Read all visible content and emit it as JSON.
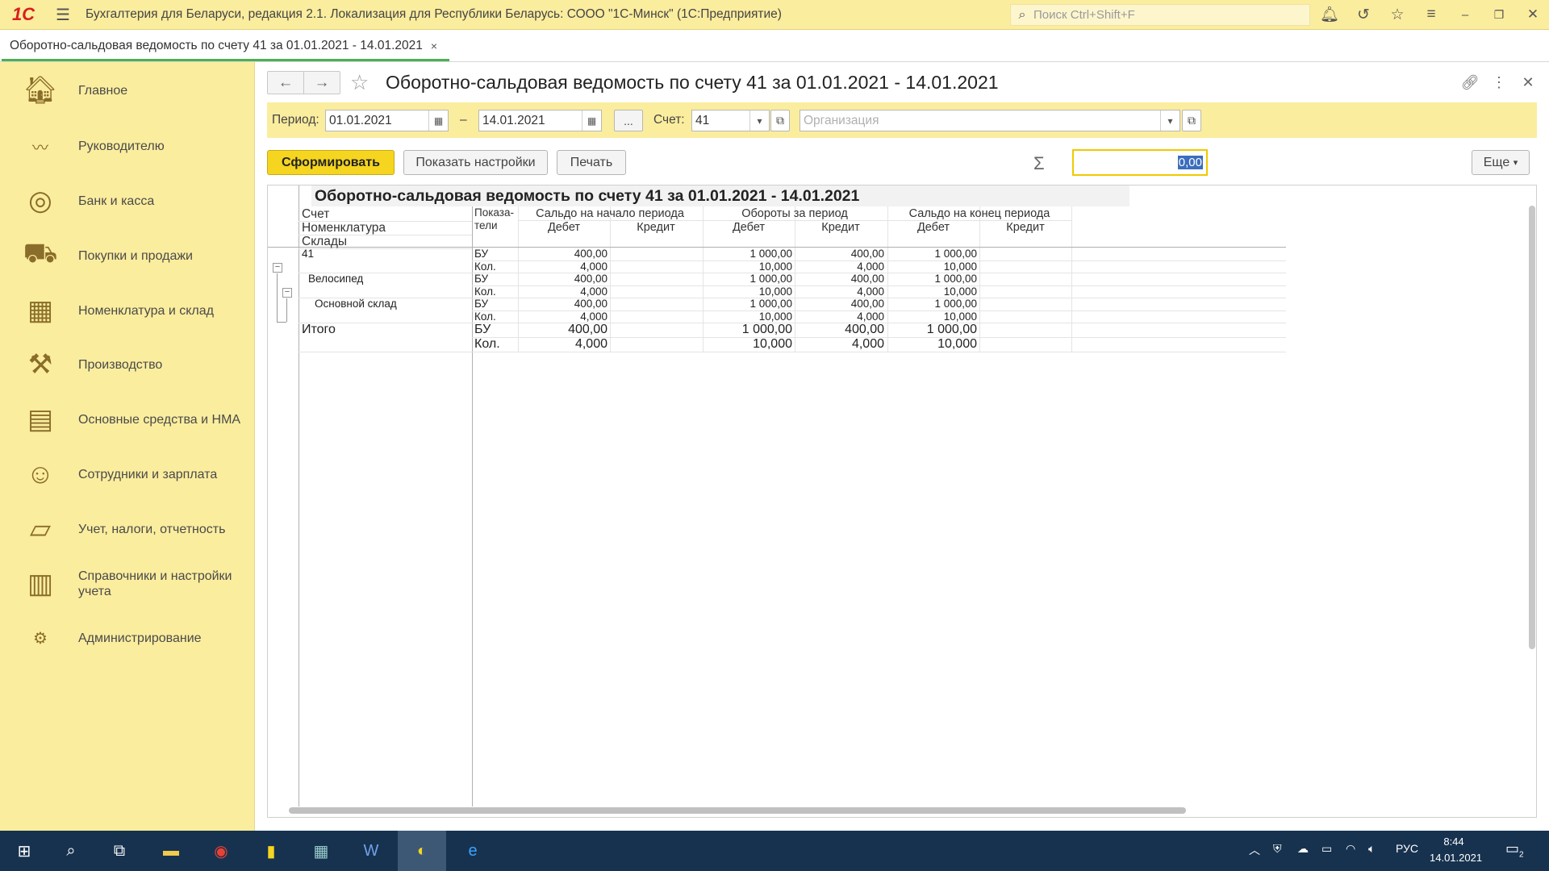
{
  "titlebar": {
    "logo": "1С",
    "app_title": "Бухгалтерия для Беларуси, редакция 2.1. Локализация для Республики Беларусь: СООО \"1С-Минск\"  (1С:Предприятие)",
    "search_placeholder": "Поиск Ctrl+Shift+F"
  },
  "tab": {
    "label": "Оборотно-сальдовая ведомость по счету 41 за 01.01.2021 - 14.01.2021",
    "close": "×"
  },
  "sidebar": {
    "items": [
      {
        "label": "Главное",
        "icon": "home-icon"
      },
      {
        "label": "Руководителю",
        "icon": "trend-icon"
      },
      {
        "label": "Банк и касса",
        "icon": "coins-icon"
      },
      {
        "label": "Покупки и продажи",
        "icon": "truck-icon"
      },
      {
        "label": "Номенклатура и склад",
        "icon": "warehouse-icon"
      },
      {
        "label": "Производство",
        "icon": "tools-icon"
      },
      {
        "label": "Основные средства и НМА",
        "icon": "assets-icon"
      },
      {
        "label": "Сотрудники и зарплата",
        "icon": "employee-icon"
      },
      {
        "label": "Учет, налоги, отчетность",
        "icon": "reports-icon"
      },
      {
        "label": "Справочники и настройки учета",
        "icon": "folders-icon"
      },
      {
        "label": "Администрирование",
        "icon": "gear-icon"
      }
    ]
  },
  "page": {
    "title": "Оборотно-сальдовая ведомость по счету 41 за 01.01.2021 - 14.01.2021"
  },
  "filters": {
    "period_label": "Период:",
    "date_from": "01.01.2021",
    "dash": "–",
    "date_to": "14.01.2021",
    "ellipsis": "...",
    "account_label": "Счет:",
    "account": "41",
    "org_placeholder": "Организация"
  },
  "commands": {
    "generate": "Сформировать",
    "show_settings": "Показать настройки",
    "print": "Печать",
    "sum_value": "0,00",
    "more": "Еще"
  },
  "report": {
    "title": "Оборотно-сальдовая ведомость по счету 41 за 01.01.2021 - 14.01.2021",
    "grouping_labels": [
      "Счет",
      "Номенклатура",
      "Склады"
    ],
    "indicators_header": "Показа-\nтели",
    "group_headers": [
      "Сальдо на начало периода",
      "Обороты за период",
      "Сальдо на конец периода"
    ],
    "sub_headers": [
      "Дебет",
      "Кредит",
      "Дебет",
      "Кредит",
      "Дебет",
      "Кредит"
    ],
    "rows": [
      {
        "name": "41",
        "ind": "БУ",
        "vals": [
          "400,00",
          "",
          "1 000,00",
          "400,00",
          "1 000,00",
          ""
        ]
      },
      {
        "name": "",
        "ind": "Кол.",
        "vals": [
          "4,000",
          "",
          "10,000",
          "4,000",
          "10,000",
          ""
        ]
      },
      {
        "name": "Велосипед",
        "ind": "БУ",
        "vals": [
          "400,00",
          "",
          "1 000,00",
          "400,00",
          "1 000,00",
          ""
        ]
      },
      {
        "name": "",
        "ind": "Кол.",
        "vals": [
          "4,000",
          "",
          "10,000",
          "4,000",
          "10,000",
          ""
        ]
      },
      {
        "name": "Основной склад",
        "ind": "БУ",
        "vals": [
          "400,00",
          "",
          "1 000,00",
          "400,00",
          "1 000,00",
          ""
        ]
      },
      {
        "name": "",
        "ind": "Кол.",
        "vals": [
          "4,000",
          "",
          "10,000",
          "4,000",
          "10,000",
          ""
        ]
      },
      {
        "name": "Итого",
        "ind": "БУ",
        "vals": [
          "400,00",
          "",
          "1 000,00",
          "400,00",
          "1 000,00",
          ""
        ]
      },
      {
        "name": "",
        "ind": "Кол.",
        "vals": [
          "4,000",
          "",
          "10,000",
          "4,000",
          "10,000",
          ""
        ]
      }
    ]
  },
  "taskbar": {
    "lang": "РУС",
    "time": "8:44",
    "date": "14.01.2021",
    "notif_count": "2"
  },
  "colors": {
    "accent_yellow": "#fbed9e",
    "button_yellow": "#f5d51f",
    "taskbar": "#17324f"
  }
}
